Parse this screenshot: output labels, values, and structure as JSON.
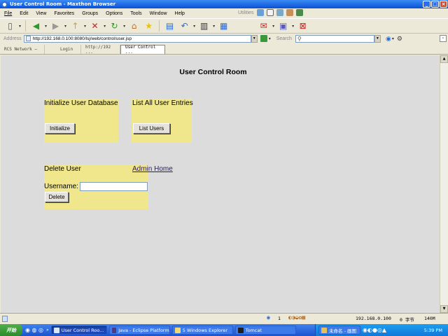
{
  "window": {
    "title": "User Control Room - Maxthon Browser"
  },
  "menu": [
    "File",
    "Edit",
    "View",
    "Favorites",
    "Groups",
    "Options",
    "Tools",
    "Window",
    "Help"
  ],
  "menu_right": {
    "utilities": "Utilities"
  },
  "address": {
    "label": "Address",
    "url": "http://192.168.0.100:8080/lsj/web/control/user.jsp",
    "search_label": "Search"
  },
  "tabs": [
    {
      "label": "RCS Network —"
    },
    {
      "label": "Login"
    },
    {
      "label": "http://192 ..."
    },
    {
      "label": "User Control ..."
    }
  ],
  "page": {
    "title": "User Control Room",
    "init_panel": {
      "heading": "Initialize User Database",
      "button": "Initialize"
    },
    "list_panel": {
      "heading": "List All User Entries",
      "button": "List Users"
    },
    "delete_panel": {
      "heading": "Delete User",
      "admin_link": "Admin Home",
      "username_label": "Username:",
      "username_value": "",
      "button": "Delete"
    }
  },
  "status": {
    "count": "1",
    "ip": "192.168.0.100",
    "bytes": "0 字节",
    "memory": "140M"
  },
  "taskbar": {
    "start": "开始",
    "tasks": [
      "User Control Roo...",
      "Java - Eclipse Platform",
      "5 Windows Explorer",
      "Tomcat",
      "未命名 - 画图"
    ],
    "clock": "5:39 PM"
  },
  "colors": {
    "panel": "#f0e68c",
    "page_bg": "#dcdcdc",
    "link": "#2b1d5a"
  }
}
